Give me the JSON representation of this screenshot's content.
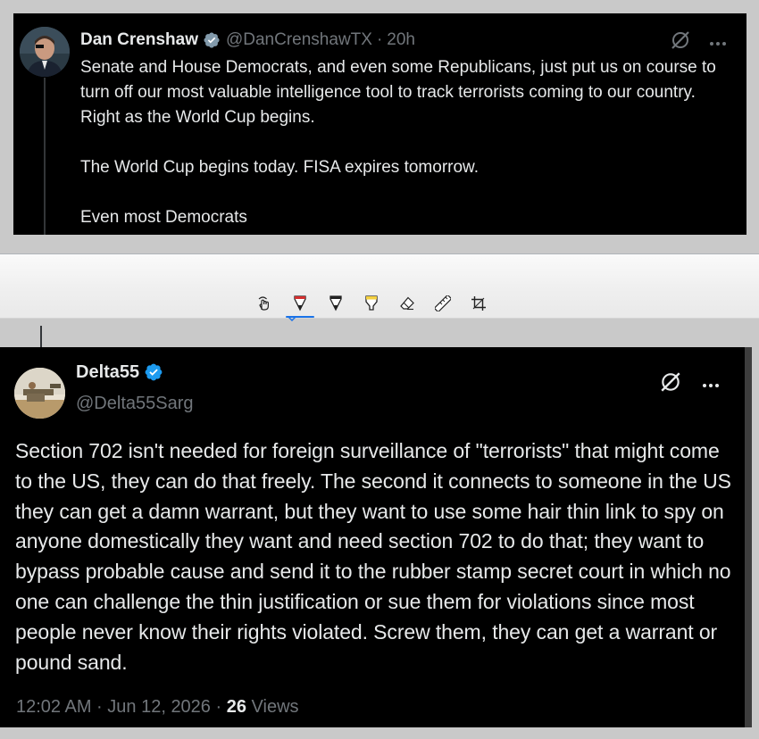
{
  "top_tweet": {
    "author_name": "Dan Crenshaw",
    "handle": "@DanCrenshawTX",
    "separator": "·",
    "time": "20h",
    "paragraphs": [
      "Senate and House Democrats, and even some Republicans, just put us on course to turn off our most valuable intelligence tool to track terrorists coming to our country. Right as the World Cup begins.",
      "The World Cup begins today. FISA expires tomorrow.",
      "Even most Democrats"
    ],
    "verified_badge_color": "#829aab"
  },
  "toolbar": {
    "tools": [
      {
        "icon": "touch-hand-icon",
        "active": false
      },
      {
        "icon": "ballpoint-pen-icon",
        "active": true
      },
      {
        "icon": "pen-icon",
        "active": false
      },
      {
        "icon": "highlighter-icon",
        "active": false
      },
      {
        "icon": "eraser-icon",
        "active": false
      },
      {
        "icon": "ruler-icon",
        "active": false
      },
      {
        "icon": "crop-icon",
        "active": false
      }
    ],
    "accent_color": "#1a73e8"
  },
  "main_tweet": {
    "author_name": "Delta55",
    "handle": "@Delta55Sarg",
    "body": "Section 702 isn't needed for foreign surveillance of \"terrorists\" that might come to the US, they can do that freely.  The second it connects to someone in the US they can get a damn warrant, but they want to use some hair thin link to spy on anyone domestically they want and need section 702 to do that; they want to bypass probable cause and send it to the rubber stamp secret court in which no one can challenge the thin justification or sue them for violations since most people never know their rights violated.  Screw them, they can get a warrant or pound sand.",
    "timestamp": "12:02 AM · Jun 12, 2026 ·",
    "views_count": "26",
    "views_label": "Views",
    "verified_badge_color": "#1d9bf0"
  }
}
